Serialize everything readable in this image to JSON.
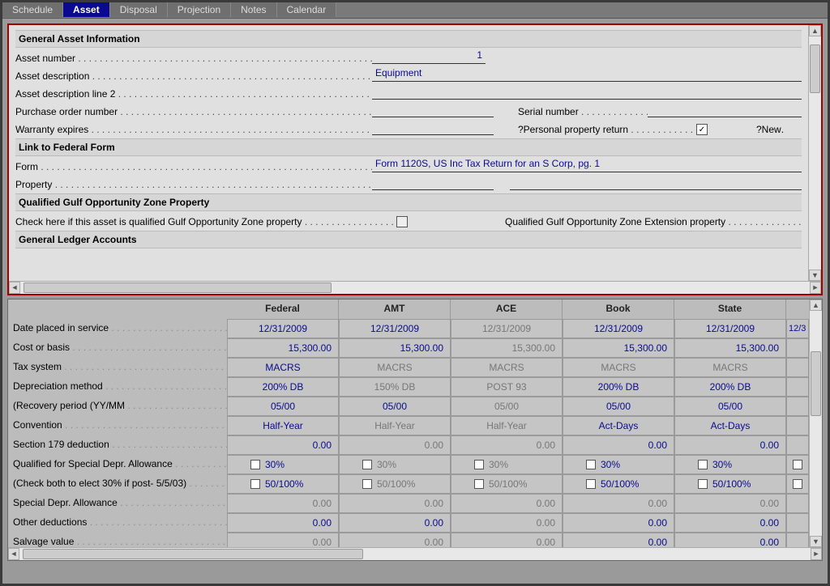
{
  "tabs": [
    "Schedule",
    "Asset",
    "Disposal",
    "Projection",
    "Notes",
    "Calendar"
  ],
  "active_tab": 1,
  "sections": {
    "gai": "General Asset Information",
    "lff": "Link to Federal Form",
    "goz": "Qualified Gulf Opportunity Zone Property",
    "gla": "General Ledger Accounts"
  },
  "labels": {
    "asset_number": "Asset number",
    "asset_description": "Asset description",
    "asset_description2": "Asset description line 2",
    "po_number": "Purchase order number",
    "serial_number": "Serial number",
    "warranty_expires": "Warranty expires",
    "personal_property": "?Personal property return",
    "new": "?New",
    "form": "Form",
    "property": "Property",
    "goz_check": "Check here if this asset is qualified Gulf Opportunity Zone property",
    "goz_ext": "Qualified Gulf Opportunity Zone Extension property"
  },
  "values": {
    "asset_number": "1",
    "asset_description": "Equipment",
    "asset_description2": "",
    "po_number": "",
    "serial_number": "",
    "warranty_expires": "",
    "personal_property_checked": true,
    "form": "Form 1120S, US Inc Tax Return for an S Corp, pg. 1",
    "property1": "",
    "property2": ""
  },
  "grid": {
    "columns": [
      "Federal",
      "AMT",
      "ACE",
      "Book",
      "State"
    ],
    "tail_col_value": "12/3",
    "rows": [
      {
        "label": "Date placed in service",
        "cells": [
          {
            "v": "12/31/2009"
          },
          {
            "v": "12/31/2009"
          },
          {
            "v": "12/31/2009",
            "dis": true
          },
          {
            "v": "12/31/2009"
          },
          {
            "v": "12/31/2009"
          }
        ],
        "type": "center"
      },
      {
        "label": "Cost or basis",
        "cells": [
          {
            "v": "15,300.00"
          },
          {
            "v": "15,300.00"
          },
          {
            "v": "15,300.00",
            "dis": true
          },
          {
            "v": "15,300.00"
          },
          {
            "v": "15,300.00"
          }
        ],
        "type": "right"
      },
      {
        "label": "Tax system",
        "cells": [
          {
            "v": "MACRS"
          },
          {
            "v": "MACRS",
            "dis": true
          },
          {
            "v": "MACRS",
            "dis": true
          },
          {
            "v": "MACRS",
            "dis": true
          },
          {
            "v": "MACRS",
            "dis": true
          }
        ],
        "type": "center"
      },
      {
        "label": "Depreciation method",
        "cells": [
          {
            "v": "200% DB"
          },
          {
            "v": "150% DB",
            "dis": true
          },
          {
            "v": "POST 93",
            "dis": true
          },
          {
            "v": "200% DB"
          },
          {
            "v": "200% DB"
          }
        ],
        "type": "center"
      },
      {
        "label": "(Recovery period (YY/MM",
        "cells": [
          {
            "v": "05/00"
          },
          {
            "v": "05/00"
          },
          {
            "v": "05/00",
            "dis": true
          },
          {
            "v": "05/00"
          },
          {
            "v": "05/00"
          }
        ],
        "type": "center"
      },
      {
        "label": "Convention",
        "cells": [
          {
            "v": "Half-Year"
          },
          {
            "v": "Half-Year",
            "dis": true
          },
          {
            "v": "Half-Year",
            "dis": true
          },
          {
            "v": "Act-Days"
          },
          {
            "v": "Act-Days"
          }
        ],
        "type": "center"
      },
      {
        "label": "Section 179 deduction",
        "cells": [
          {
            "v": "0.00"
          },
          {
            "v": "0.00",
            "dis": true
          },
          {
            "v": "0.00",
            "dis": true
          },
          {
            "v": "0.00"
          },
          {
            "v": "0.00"
          }
        ],
        "type": "right"
      },
      {
        "label": "Qualified for Special Depr. Allowance",
        "cells": [
          {
            "v": "30%",
            "cb": true
          },
          {
            "v": "30%",
            "cb": true,
            "dis": true
          },
          {
            "v": "30%",
            "cb": true,
            "dis": true
          },
          {
            "v": "30%",
            "cb": true
          },
          {
            "v": "30%",
            "cb": true
          }
        ],
        "type": "cb",
        "tailcb": true
      },
      {
        "label": "(Check both to elect 30% if post- 5/5/03)",
        "cells": [
          {
            "v": "50/100%",
            "cb": true
          },
          {
            "v": "50/100%",
            "cb": true,
            "dis": true
          },
          {
            "v": "50/100%",
            "cb": true,
            "dis": true
          },
          {
            "v": "50/100%",
            "cb": true
          },
          {
            "v": "50/100%",
            "cb": true
          }
        ],
        "type": "cb",
        "tailcb": true
      },
      {
        "label": "Special Depr. Allowance",
        "cells": [
          {
            "v": "0.00",
            "dis": true
          },
          {
            "v": "0.00",
            "dis": true
          },
          {
            "v": "0.00",
            "dis": true
          },
          {
            "v": "0.00",
            "dis": true
          },
          {
            "v": "0.00",
            "dis": true
          }
        ],
        "type": "right"
      },
      {
        "label": "Other deductions",
        "cells": [
          {
            "v": "0.00"
          },
          {
            "v": "0.00"
          },
          {
            "v": "0.00",
            "dis": true
          },
          {
            "v": "0.00"
          },
          {
            "v": "0.00"
          }
        ],
        "type": "right"
      },
      {
        "label": "Salvage value",
        "cells": [
          {
            "v": "0.00",
            "dis": true
          },
          {
            "v": "0.00",
            "dis": true
          },
          {
            "v": "0.00",
            "dis": true
          },
          {
            "v": "0.00"
          },
          {
            "v": "0.00"
          }
        ],
        "type": "right"
      }
    ]
  }
}
